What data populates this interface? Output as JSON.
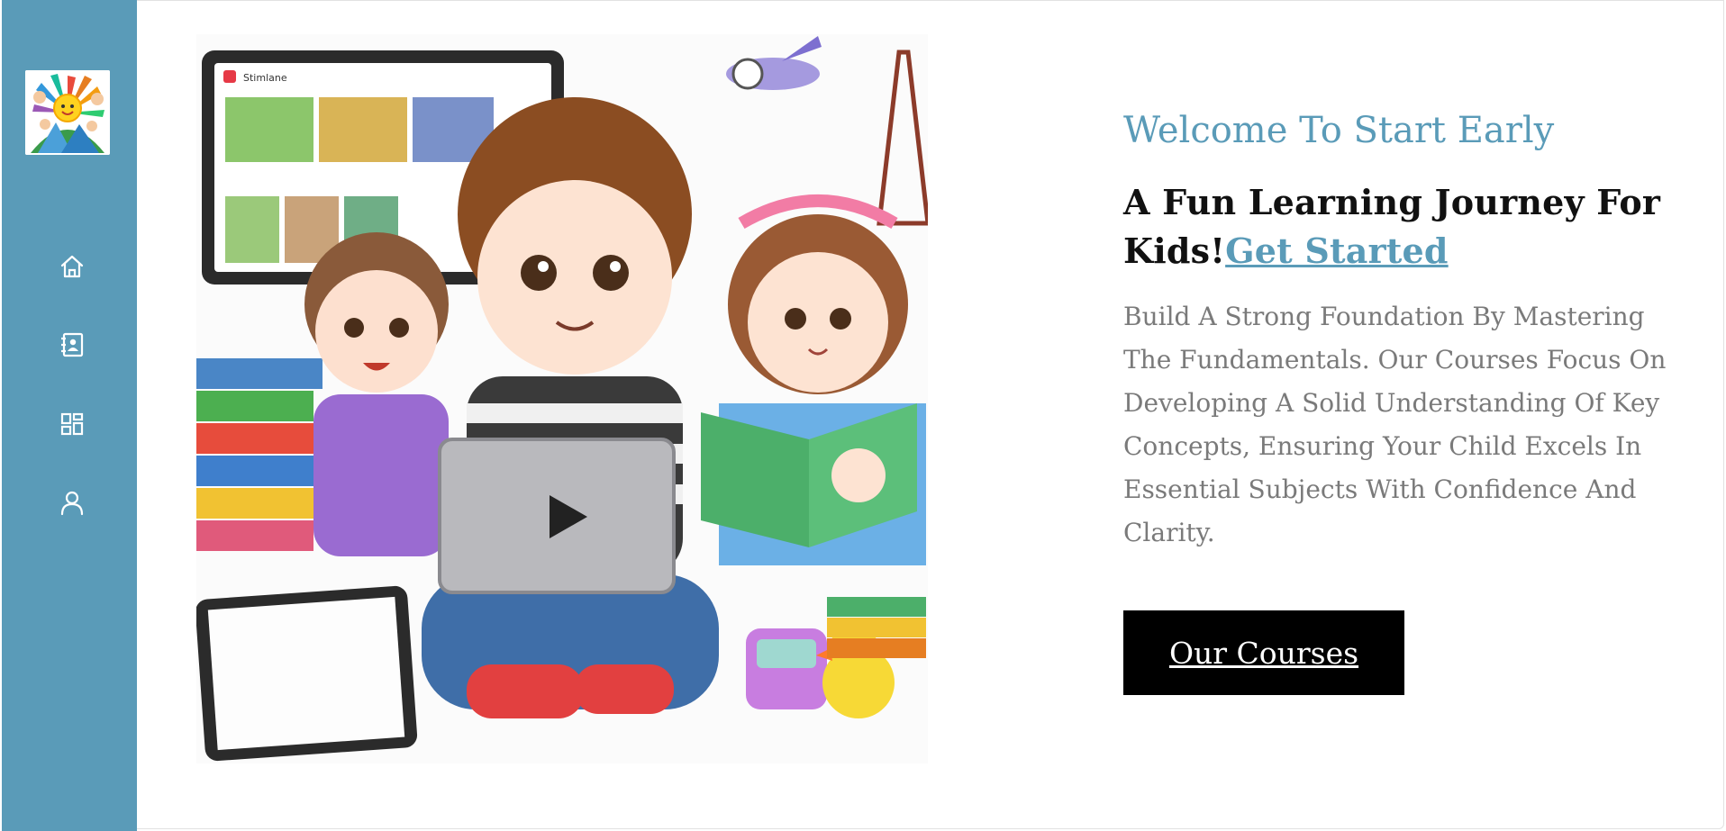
{
  "sidebar": {
    "logo_name": "start-early-logo",
    "nav": [
      {
        "name": "home-icon"
      },
      {
        "name": "contact-card-icon"
      },
      {
        "name": "dashboard-grid-icon"
      },
      {
        "name": "user-icon"
      }
    ],
    "color": "#5a9bb8"
  },
  "hero": {
    "image_name": "kids-learning-illustration",
    "mini_screen_label": "Stimlane"
  },
  "main": {
    "welcome": "Welcome To Start Early",
    "headline": "A Fun Learning Journey For Kids!",
    "link": "Get Started",
    "description": "Build A Strong Foundation By Mastering The Fundamentals. Our Courses Focus On Developing A Solid Understanding Of Key Concepts, Ensuring Your Child Excels In Essential Subjects With Confidence And Clarity.",
    "button": "Our Courses"
  },
  "colors": {
    "accent": "#5a9bb8",
    "button_bg": "#000000",
    "text_muted": "#7a7a7a"
  }
}
